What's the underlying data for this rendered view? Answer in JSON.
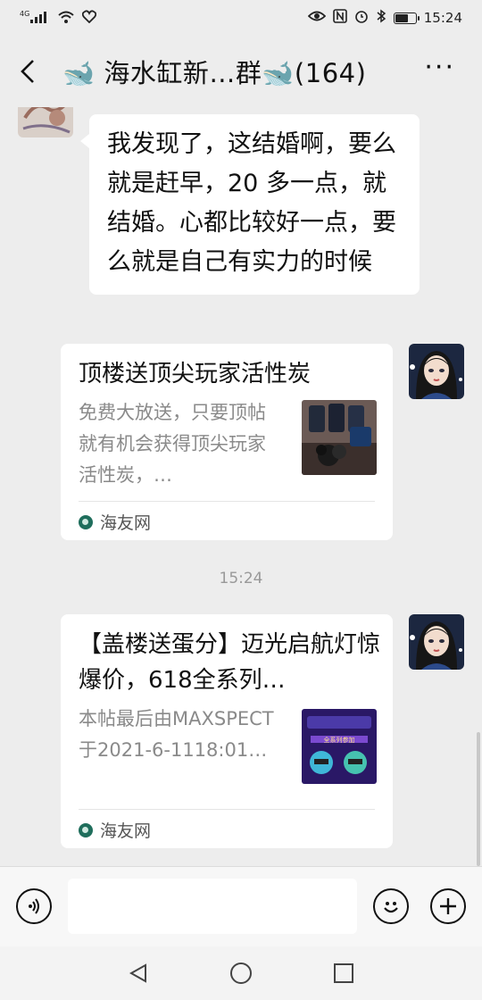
{
  "status_bar": {
    "network": "4G",
    "time": "15:24",
    "battery_level": 0.7,
    "icons": [
      "signal-icon",
      "wifi-icon",
      "heart-icon",
      "eye-icon",
      "nfc-icon",
      "alarm-icon",
      "bluetooth-icon",
      "battery-icon"
    ]
  },
  "header": {
    "title": "🐋 海水缸新…群🐋(164)",
    "more_label": "···"
  },
  "messages": {
    "text_message": {
      "text": "我发现了，这结婚啊，要么就是赶早，20 多一点，就结婚。心都比较好一点，要么就是自己有实力的时候"
    },
    "card1": {
      "title": "顶楼送顶尖玩家活性炭",
      "description": "免费大放送，只要顶帖就有机会获得顶尖玩家活性炭，…",
      "source": "海友网"
    },
    "timestamp": "15:24",
    "card2": {
      "title": "【盖楼送蛋分】迈光启航灯惊爆价，618全系列…",
      "description": "本帖最后由MAXSPECT于2021-6-1118:01…",
      "source": "海友网",
      "thumb_text": "全系列参加"
    }
  },
  "input_bar": {
    "voice_icon": "voice-icon",
    "emoji_icon": "emoji-icon",
    "plus_icon": "plus-icon"
  },
  "nav_bar": {
    "icons": [
      "back-triangle-icon",
      "home-circle-icon",
      "recents-square-icon"
    ]
  }
}
